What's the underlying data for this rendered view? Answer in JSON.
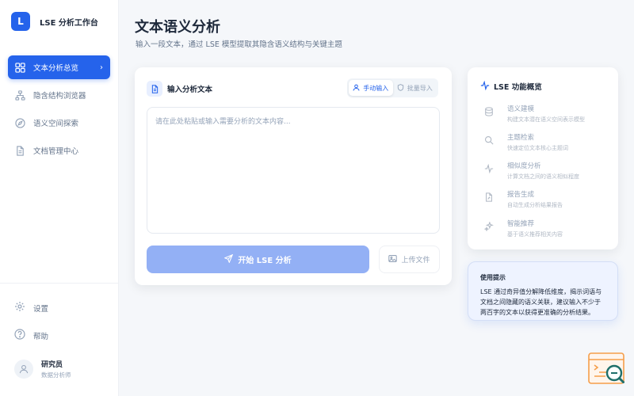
{
  "app": {
    "logo_letter": "L",
    "name": "LSE 分析工作台"
  },
  "nav": [
    {
      "label": "文本分析总览",
      "icon": "dashboard-icon",
      "active": true
    },
    {
      "label": "隐含结构浏览器",
      "icon": "hierarchy-icon",
      "active": false
    },
    {
      "label": "语义空间探索",
      "icon": "compass-icon",
      "active": false
    },
    {
      "label": "文档管理中心",
      "icon": "document-icon",
      "active": false
    }
  ],
  "bottom_nav": [
    {
      "label": "设置",
      "icon": "gear-icon"
    },
    {
      "label": "帮助",
      "icon": "help-icon"
    }
  ],
  "user": {
    "name": "研究员",
    "role": "数据分析师"
  },
  "page": {
    "title": "文本语义分析",
    "subtitle": "输入一段文本，通过 LSE 模型提取其隐含语义结构与关键主题"
  },
  "input_card": {
    "title": "输入分析文本",
    "tabs": [
      {
        "label": "手动输入",
        "icon": "person-icon",
        "active": true
      },
      {
        "label": "批量导入",
        "icon": "shield-icon",
        "active": false
      }
    ],
    "placeholder": "请在此处粘贴或输入需要分析的文本内容...",
    "primary_button": "开始 LSE 分析",
    "secondary_button": "上传文件"
  },
  "feature_panel": {
    "title": "LSE 功能概览",
    "items": [
      {
        "name": "语义建模",
        "desc": "构建文本潜在语义空间表示模型",
        "icon": "database-icon"
      },
      {
        "name": "主题检索",
        "desc": "快速定位文本核心主题词",
        "icon": "search-icon"
      },
      {
        "name": "相似度分析",
        "desc": "计算文档之间的语义相似程度",
        "icon": "activity-icon"
      },
      {
        "name": "报告生成",
        "desc": "自动生成分析结果报告",
        "icon": "file-icon"
      },
      {
        "name": "智能推荐",
        "desc": "基于语义推荐相关内容",
        "icon": "sparkle-icon"
      }
    ]
  },
  "note": {
    "title": "使用提示",
    "body": "LSE 通过奇异值分解降低维度，揭示词语与文档之间隐藏的语义关联，建议输入不少于两百字的文本以获得更准确的分析结果。"
  },
  "colors": {
    "accent": "#2563eb",
    "accent_light": "#93b0f5",
    "background": "#f5f7fa"
  }
}
